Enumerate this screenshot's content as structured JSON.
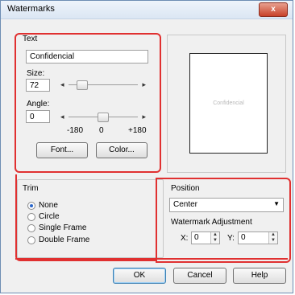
{
  "window": {
    "title": "Watermarks",
    "close_label": "x"
  },
  "text_group": {
    "title": "Text",
    "text_value": "Confidencial",
    "size_label": "Size:",
    "size_value": "72",
    "angle_label": "Angle:",
    "angle_value": "0",
    "angle_min": "-180",
    "angle_mid": "0",
    "angle_max": "+180",
    "font_button": "Font...",
    "color_button": "Color..."
  },
  "preview": {
    "text": "Confidencial"
  },
  "trim_group": {
    "title": "Trim",
    "options": [
      {
        "label": "None",
        "selected": true
      },
      {
        "label": "Circle",
        "selected": false
      },
      {
        "label": "Single Frame",
        "selected": false
      },
      {
        "label": "Double Frame",
        "selected": false
      }
    ]
  },
  "position_group": {
    "title": "Position",
    "selected": "Center",
    "adjust_label": "Watermark Adjustment",
    "x_label": "X:",
    "x_value": "0",
    "y_label": "Y:",
    "y_value": "0"
  },
  "buttons": {
    "ok": "OK",
    "cancel": "Cancel",
    "help": "Help"
  }
}
